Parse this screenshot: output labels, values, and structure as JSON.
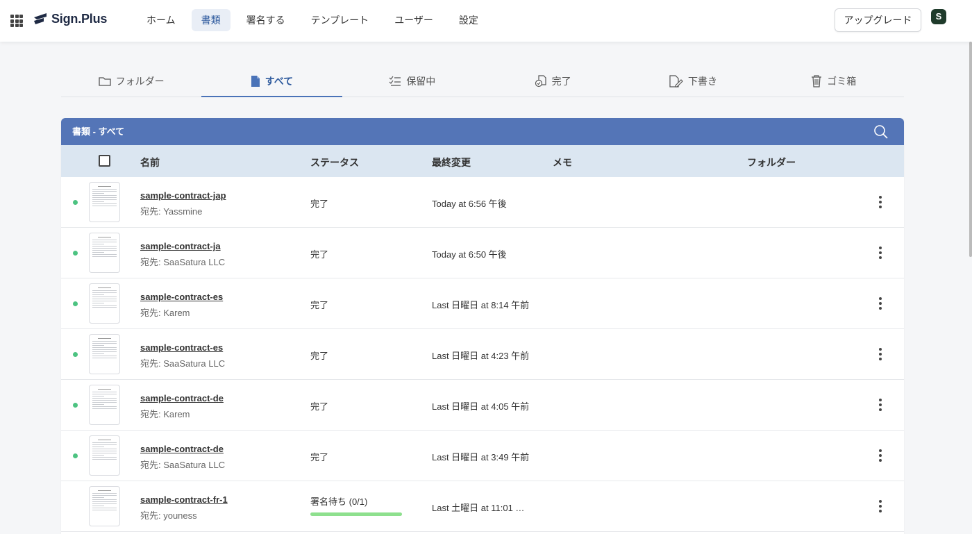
{
  "app": {
    "brand": "Sign.Plus",
    "nav": [
      {
        "label": "ホーム",
        "active": false
      },
      {
        "label": "書類",
        "active": true
      },
      {
        "label": "署名する",
        "active": false
      },
      {
        "label": "テンプレート",
        "active": false
      },
      {
        "label": "ユーザー",
        "active": false
      },
      {
        "label": "設定",
        "active": false
      }
    ],
    "upgrade_label": "アップグレード",
    "avatar_letter": "S"
  },
  "tabs": [
    {
      "label": "フォルダー",
      "icon": "folder-icon",
      "active": false
    },
    {
      "label": "すべて",
      "icon": "document-icon",
      "active": true
    },
    {
      "label": "保留中",
      "icon": "checklist-icon",
      "active": false
    },
    {
      "label": "完了",
      "icon": "completed-docs-icon",
      "active": false
    },
    {
      "label": "下書き",
      "icon": "draft-icon",
      "active": false
    },
    {
      "label": "ゴミ箱",
      "icon": "trash-icon",
      "active": false
    }
  ],
  "table": {
    "title": "書類 - すべて",
    "columns": {
      "name": "名前",
      "status": "ステータス",
      "modified": "最終変更",
      "memo": "メモ",
      "folder": "フォルダー"
    },
    "rows": [
      {
        "name": "sample-contract-jap",
        "recipient": "宛先: Yassmine",
        "status": "完了",
        "modified": "Today at 6:56 午後",
        "dot": true,
        "progress": null
      },
      {
        "name": "sample-contract-ja",
        "recipient": "宛先: SaaSatura LLC",
        "status": "完了",
        "modified": "Today at 6:50 午後",
        "dot": true,
        "progress": null
      },
      {
        "name": "sample-contract-es",
        "recipient": "宛先: Karem",
        "status": "完了",
        "modified": "Last 日曜日 at 8:14 午前",
        "dot": true,
        "progress": null
      },
      {
        "name": "sample-contract-es",
        "recipient": "宛先: SaaSatura LLC",
        "status": "完了",
        "modified": "Last 日曜日 at 4:23 午前",
        "dot": true,
        "progress": null
      },
      {
        "name": "sample-contract-de",
        "recipient": "宛先: Karem",
        "status": "完了",
        "modified": "Last 日曜日 at 4:05 午前",
        "dot": true,
        "progress": null
      },
      {
        "name": "sample-contract-de",
        "recipient": "宛先: SaaSatura LLC",
        "status": "完了",
        "modified": "Last 日曜日 at 3:49 午前",
        "dot": true,
        "progress": null
      },
      {
        "name": "sample-contract-fr-1",
        "recipient": "宛先: youness",
        "status": "署名待ち (0/1)",
        "modified": "Last 土曜日 at 11:01 …",
        "dot": false,
        "progress": 1.0
      }
    ]
  },
  "colors": {
    "accent": "#5475b7",
    "header_row": "#dbe6f1",
    "completed_dot": "#4cc381",
    "progress": "#8ee08e"
  }
}
